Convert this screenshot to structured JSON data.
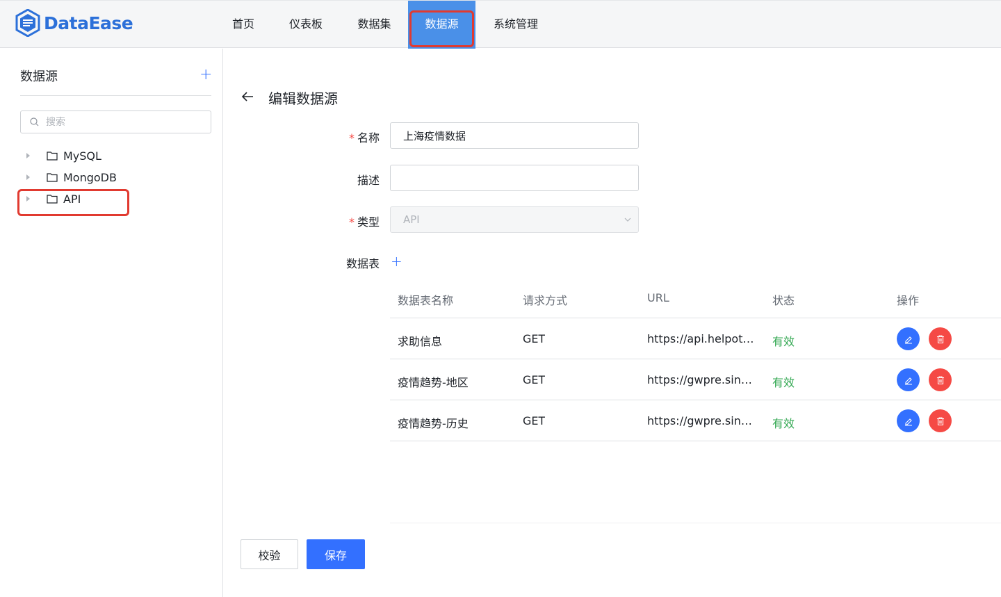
{
  "app": {
    "name": "DataEase",
    "accent": "#3370ff"
  },
  "nav": {
    "items": [
      {
        "label": "首页"
      },
      {
        "label": "仪表板"
      },
      {
        "label": "数据集"
      },
      {
        "label": "数据源",
        "active": true
      },
      {
        "label": "系统管理"
      }
    ]
  },
  "sidebar": {
    "title": "数据源",
    "search_placeholder": "搜索",
    "tree": [
      {
        "label": "MySQL"
      },
      {
        "label": "MongoDB"
      },
      {
        "label": "API"
      }
    ]
  },
  "form": {
    "page_title": "编辑数据源",
    "name_label": "名称",
    "name_value": "上海疫情数据",
    "desc_label": "描述",
    "desc_value": "",
    "type_label": "类型",
    "type_value": "API",
    "table_label": "数据表"
  },
  "table": {
    "headers": [
      "数据表名称",
      "请求方式",
      "URL",
      "状态",
      "操作"
    ],
    "rows": [
      {
        "name": "求助信息",
        "method": "GET",
        "url": "https://api.helpoth…",
        "status": "有效"
      },
      {
        "name": "疫情趋势-地区",
        "method": "GET",
        "url": "https://gwpre.sina…",
        "status": "有效"
      },
      {
        "name": "疫情趋势-历史",
        "method": "GET",
        "url": "https://gwpre.sina…",
        "status": "有效"
      }
    ]
  },
  "buttons": {
    "verify": "校验",
    "save": "保存"
  }
}
